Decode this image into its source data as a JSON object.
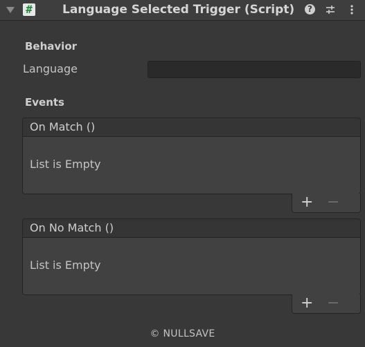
{
  "header": {
    "title": "Language Selected Trigger (Script)",
    "script_icon": "#",
    "help_icon": "?",
    "icons": [
      "foldout-arrow-icon",
      "script-icon",
      "help-icon",
      "preset-icon",
      "kebab-menu-icon"
    ]
  },
  "behavior": {
    "section_label": "Behavior",
    "language_label": "Language",
    "language_value": ""
  },
  "events": {
    "section_label": "Events",
    "on_match": {
      "label": "On Match ()",
      "empty_text": "List is Empty",
      "add": "+",
      "remove": "−"
    },
    "on_no_match": {
      "label": "On No Match ()",
      "empty_text": "List is Empty",
      "add": "+",
      "remove": "−"
    }
  },
  "footer": {
    "copyright": "© NULLSAVE"
  }
}
